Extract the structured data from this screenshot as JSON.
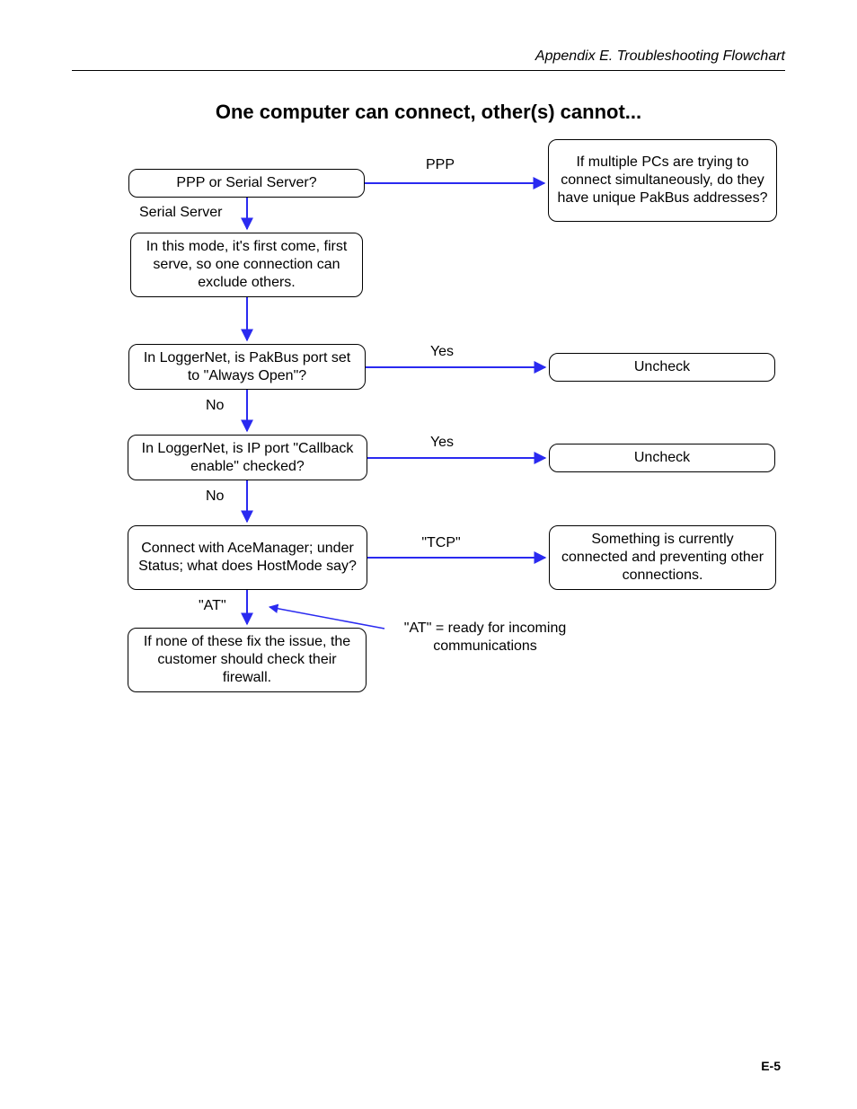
{
  "header": {
    "right_text": "Appendix E.  Troubleshooting Flowchart"
  },
  "title": "One computer can connect, other(s) cannot...",
  "footer": {
    "page_number": "E-5"
  },
  "nodes": {
    "q1": "PPP or Serial Server?",
    "ppp_result": "If multiple PCs are trying to connect simultaneously, do they have unique PakBus addresses?",
    "serial_info": "In this mode, it's first come, first serve, so one connection can exclude others.",
    "q2": "In LoggerNet, is PakBus port set to \"Always Open\"?",
    "uncheck1": "Uncheck",
    "q3": "In LoggerNet, is IP port \"Callback enable\" checked?",
    "uncheck2": "Uncheck",
    "q4": "Connect with AceManager; under Status; what does HostMode say?",
    "tcp_result": "Something is currently connected and preventing other connections.",
    "final": "If none of these fix the issue, the customer should check their firewall."
  },
  "labels": {
    "ppp": "PPP",
    "serial_server": "Serial Server",
    "yes1": "Yes",
    "no1": "No",
    "yes2": "Yes",
    "no2": "No",
    "tcp": "\"TCP\"",
    "at": "\"AT\"",
    "at_note": "\"AT\" = ready for incoming communications"
  },
  "colors": {
    "arrow": "#2a2af0"
  }
}
